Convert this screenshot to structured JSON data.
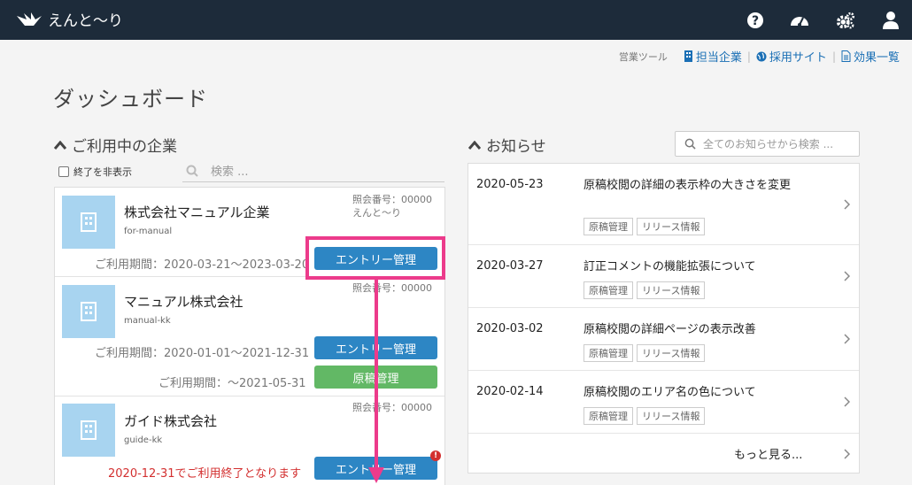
{
  "header": {
    "app_name": "えんと〜り"
  },
  "toolbar": {
    "label": "営業ツール",
    "links": [
      "担当企業",
      "採用サイト",
      "効果一覧"
    ]
  },
  "page_title": "ダッシュボード",
  "companies_section": {
    "title": "ご利用中の企業",
    "hide_ended_label": "終了を非表示",
    "search_placeholder": "検索 ...",
    "items": [
      {
        "name": "株式会社マニュアル企業",
        "code": "for-manual",
        "ref_no": "照会番号：00000",
        "owner": "えんと〜り",
        "entry_period": "ご利用期間：2020-03-21〜2023-03-20",
        "entry_button": "エントリー管理"
      },
      {
        "name": "マニュアル株式会社",
        "code": "manual-kk",
        "ref_no": "照会番号：00000",
        "entry_period": "ご利用期間：2020-01-01〜2021-12-31",
        "entry_button": "エントリー管理",
        "manuscript_period": "ご利用期間：〜2021-05-31",
        "manuscript_button": "原稿管理"
      },
      {
        "name": "ガイド株式会社",
        "code": "guide-kk",
        "ref_no": "照会番号：00000",
        "warning": "2020-12-31でご利用終了となります",
        "entry_button": "エントリー管理",
        "badge": "!"
      }
    ]
  },
  "news_section": {
    "title": "お知らせ",
    "search_placeholder": "全てのお知らせから検索 ...",
    "items": [
      {
        "date": "2020-05-23",
        "title": "原稿校閲の詳細の表示枠の大きさを変更",
        "tags": [
          "原稿管理",
          "リリース情報"
        ]
      },
      {
        "date": "2020-03-27",
        "title": "訂正コメントの機能拡張について",
        "tags": [
          "原稿管理",
          "リリース情報"
        ]
      },
      {
        "date": "2020-03-02",
        "title": "原稿校閲の詳細ページの表示改善",
        "tags": [
          "原稿管理",
          "リリース情報"
        ]
      },
      {
        "date": "2020-02-14",
        "title": "原稿校閲のエリア名の色について",
        "tags": [
          "原稿管理",
          "リリース情報"
        ]
      }
    ],
    "more_label": "もっと見る..."
  },
  "colors": {
    "header_bg": "#1d2b3a",
    "primary_button": "#2d86c4",
    "success_button": "#62b865",
    "annotation": "#ec3b8b",
    "warning": "#d32f2f"
  }
}
